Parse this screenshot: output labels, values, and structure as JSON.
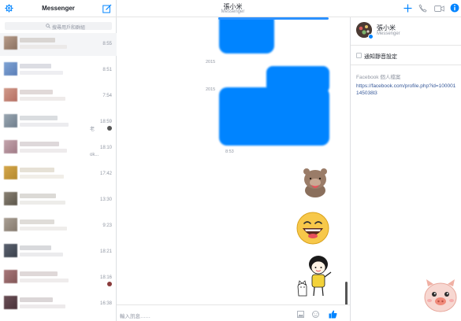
{
  "sidebar": {
    "title": "Messenger",
    "search_placeholder": "搜尋用戶和群組",
    "threads": [
      {
        "time": "8:55"
      },
      {
        "time": "8:51"
      },
      {
        "time": "7:54"
      },
      {
        "time": "18:59",
        "fragment": "老"
      },
      {
        "time": "18:10",
        "fragment": "ok..."
      },
      {
        "time": "17:42"
      },
      {
        "time": "13:30"
      },
      {
        "time": "9:23"
      },
      {
        "time": "18:21"
      },
      {
        "time": "18:16"
      },
      {
        "time": "16:38"
      }
    ]
  },
  "chat": {
    "contact_name": "張小米",
    "contact_sub": "Messenger",
    "date_separators": [
      "2015",
      "2015"
    ],
    "sent_time": "8:53",
    "composer_placeholder": "輸入訊息……"
  },
  "details": {
    "name": "張小米",
    "sub": "Messenger",
    "notify_label": "通知靜音設定",
    "section_title": "Facebook 個人檔案",
    "profile_url": "https://facebook.com/profile.php?id=100001145038l3"
  },
  "colors": {
    "accent": "#0084ff",
    "link": "#365899"
  }
}
